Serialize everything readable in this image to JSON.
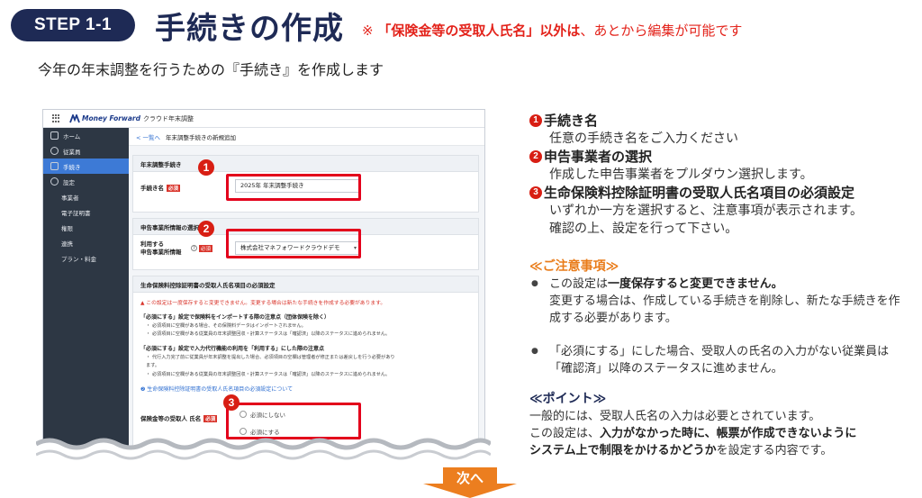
{
  "header": {
    "step": "STEP 1-1",
    "title": "手続きの作成",
    "note_mark": "※",
    "note_strong": "「保険金等の受取人氏名」以外は",
    "note_rest": "、あとから編集が可能です",
    "subtitle": "今年の年末調整を行うための『手続き』を作成します"
  },
  "app": {
    "brand": "Money Forward",
    "app_name": "クラウド年末調整",
    "sidebar": {
      "home": "ホーム",
      "employees": "従業員",
      "procedures": "手続き",
      "settings": "設定",
      "sub_items": [
        "事業者",
        "電子証明書",
        "権限",
        "連携",
        "プラン・料金"
      ]
    },
    "breadcrumb": {
      "back": "< 一覧へ",
      "current": "年末調整手続きの新規追加"
    },
    "section1": {
      "header": "年末調整手続き",
      "label": "手続き名",
      "required": "必須",
      "value": "2025年 年末調整手続き"
    },
    "section2": {
      "header": "申告事業所情報の選択",
      "label_line1": "利用する",
      "label_line2": "申告事業所情報",
      "required": "必須",
      "selected": "株式会社マネフォワードクラウドデモ"
    },
    "section3": {
      "header": "生命保険料控除証明書の受取人氏名項目の必須設定",
      "warning": "▲ この設定は一度保存すると変更できません。変更する場合は新たな手続きを作成する必要があります。",
      "block1_title": "「必須にする」設定で保険料をインポートする際の注意点（団体保険を除く）",
      "block1_lines": [
        "・ 必須項目に空欄がある場合、その保険料データはインポートされません。",
        "・ 必須項目に空欄がある従業員の年末調整回収・計算ステータスは「確認済」以降のステータスに進められません。"
      ],
      "block2_title": "「必須にする」設定で入力代行機能の利用を「利用する」にした際の注意点",
      "block2_lines": [
        "・ 代行入力完了前に従業員が年末調整を提出した場合、必須項目の空欄は管理者が修正または差戻しを行う必要があり",
        "   ます。",
        "・ 必須項目に空欄がある従業員の年末調整回収・計算ステータスは「確認済」以降のステータスに進められません。"
      ],
      "link": "❷ 生命保険料控除証明書の受取人氏名項目の必須設定について",
      "label": "保険金等の受取人 氏名",
      "required": "必須",
      "options": [
        "必須にしない",
        "必須にする"
      ]
    }
  },
  "badges": [
    "❶",
    "❷",
    "❸"
  ],
  "badge_numbers": [
    "1",
    "2",
    "3"
  ],
  "next_label": "次へ",
  "explain": {
    "items": [
      {
        "num": "1",
        "title": "手続き名",
        "desc": [
          "任意の手続き名をご入力ください"
        ]
      },
      {
        "num": "2",
        "title": "申告事業者の選択",
        "desc": [
          "作成した申告事業者をプルダウン選択します。"
        ]
      },
      {
        "num": "3",
        "title": "生命保険料控除証明書の受取人氏名項目の必須設定",
        "desc": [
          "いずれか一方を選択すると、注意事項が表示されます。",
          "確認の上、設定を行って下さい。"
        ]
      }
    ],
    "caution_title": "≪ご注意事項≫",
    "caution1_pre": "この設定は",
    "caution1_strong": "一度保存すると変更できません。",
    "caution1_cont1": "変更する場合は、作成している手続きを削除し、新たな手続きを作",
    "caution1_cont2": "成する必要があります。",
    "caution2_line1": "「必須にする」にした場合、受取人の氏名の入力がない従業員は",
    "caution2_line2": "「確認済」以降のステータスに進めません。",
    "point_title": "≪ポイント≫",
    "point_line1": "一般的には、受取人氏名の入力は必要とされています。",
    "point_line2_pre": "この設定は、",
    "point_line2_strong": "入力がなかった時に、帳票が作成できないように",
    "point_line3_strong": "システム上で制限をかけるかどうか",
    "point_line3_rest": "を設定する内容です。"
  },
  "colors": {
    "navy": "#1e2a55",
    "red": "#e3231b",
    "orange": "#e97c1a",
    "sidebar": "#2d3744",
    "active": "#3d7ad6"
  }
}
